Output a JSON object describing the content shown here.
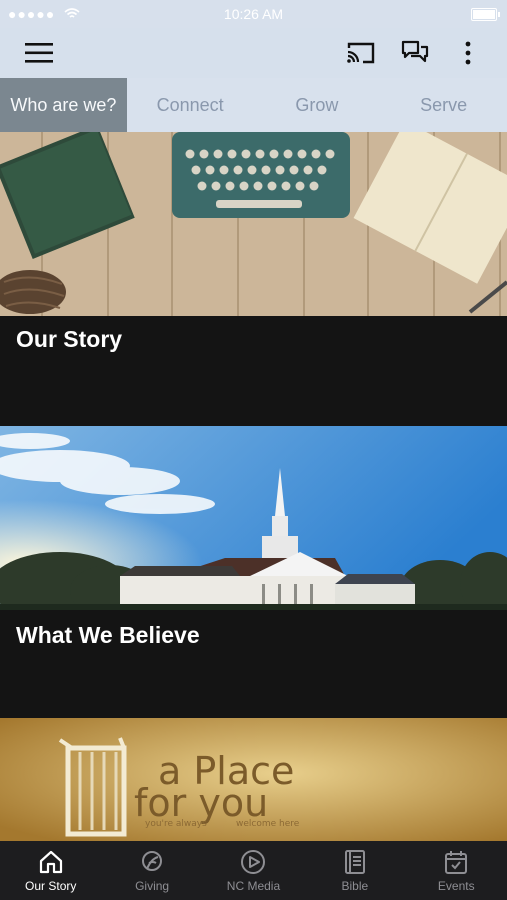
{
  "status_bar": {
    "signal": "●●●●●",
    "time": "10:26 AM"
  },
  "app_bar": {
    "menu_icon": "menu-icon",
    "actions": [
      "cast-icon",
      "chat-icon",
      "more-vert-icon"
    ]
  },
  "tabs": [
    {
      "label": "Who are we?",
      "active": true
    },
    {
      "label": "Connect",
      "active": false
    },
    {
      "label": "Grow",
      "active": false
    },
    {
      "label": "Serve",
      "active": false
    }
  ],
  "cards": [
    {
      "title": "Our Story"
    },
    {
      "title": "What We Believe"
    },
    {
      "title": "",
      "image_text": {
        "line1": "a Place",
        "line2": "for you",
        "tagline_left": "you're always",
        "tagline_right": "welcome here"
      }
    }
  ],
  "bottom_nav": [
    {
      "label": "Our Story",
      "icon": "home-icon",
      "active": true
    },
    {
      "label": "Giving",
      "icon": "giving-icon",
      "active": false
    },
    {
      "label": "NC Media",
      "icon": "play-icon",
      "active": false
    },
    {
      "label": "Bible",
      "icon": "bible-icon",
      "active": false
    },
    {
      "label": "Events",
      "icon": "calendar-icon",
      "active": false
    }
  ],
  "colors": {
    "header_bg": "#d6e0ec",
    "active_tab": "#7b8790",
    "tab_text": "#8a98ad",
    "card_bg": "#141414",
    "nav_bg": "#1d1d1f"
  }
}
